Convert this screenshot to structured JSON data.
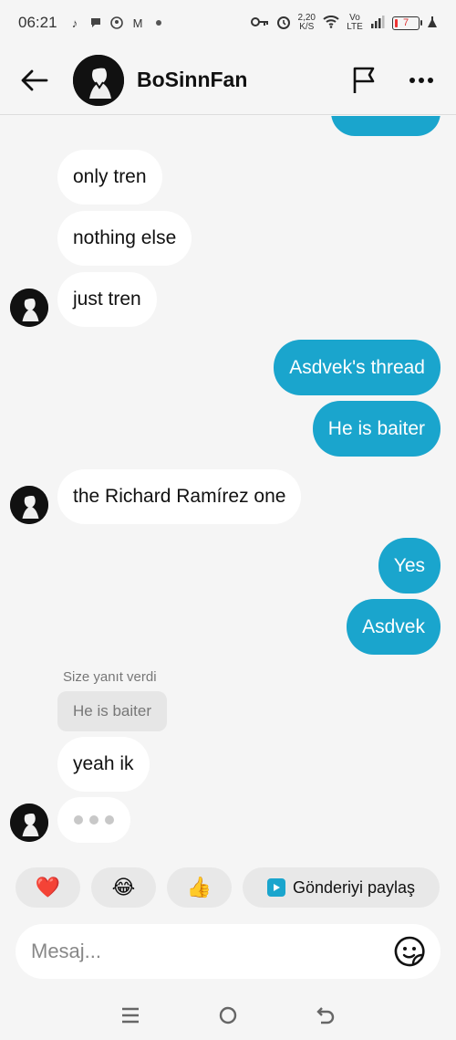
{
  "status_bar": {
    "time": "06:21",
    "speed_value": "2,20",
    "speed_unit": "K/S",
    "network": "Vo LTE",
    "battery": "7"
  },
  "header": {
    "username": "BoSinnFan"
  },
  "messages": [
    {
      "side": "in",
      "text": "only tren"
    },
    {
      "side": "in",
      "text": "nothing else"
    },
    {
      "side": "in",
      "text": "just tren"
    },
    {
      "side": "out",
      "text": "Asdvek's thread"
    },
    {
      "side": "out",
      "text": "He is baiter"
    },
    {
      "side": "in",
      "text": "the Richard Ramírez one"
    },
    {
      "side": "out",
      "text": "Yes"
    },
    {
      "side": "out",
      "text": "Asdvek"
    },
    {
      "side": "in",
      "text": "yeah ik"
    }
  ],
  "reply": {
    "meta": "Size yanıt verdi",
    "quoted": "He is baiter"
  },
  "quick_reactions": {
    "heart": "❤️",
    "laugh": "😂",
    "thumbs": "👍",
    "share_label": "Gönderiyi paylaş"
  },
  "composer": {
    "placeholder": "Mesaj..."
  },
  "colors": {
    "outgoing": "#1aa5cd",
    "incoming": "#ffffff",
    "background": "#f5f5f5"
  }
}
